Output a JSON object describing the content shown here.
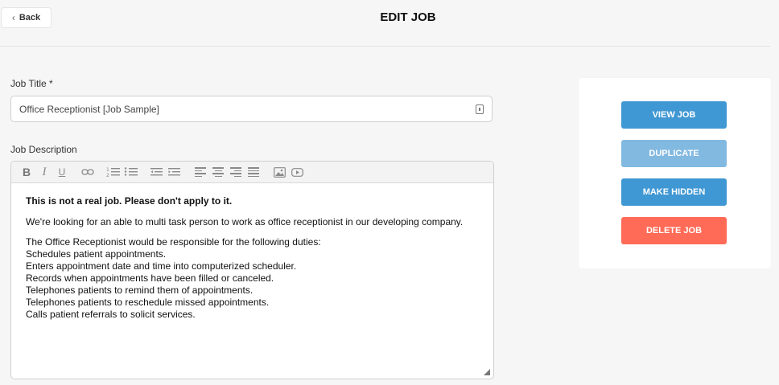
{
  "header": {
    "back_label": "Back",
    "page_title": "EDIT JOB"
  },
  "form": {
    "job_title_label": "Job Title *",
    "job_title_value": "Office Receptionist [Job Sample]",
    "job_description_label": "Job Description"
  },
  "editor": {
    "toolbar_icons": [
      "bold-icon",
      "italic-icon",
      "underline-icon",
      "link-icon",
      "ordered-list-icon",
      "bullet-list-icon",
      "outdent-icon",
      "indent-icon",
      "align-left-icon",
      "align-center-icon",
      "align-right-icon",
      "justify-icon",
      "image-icon",
      "video-icon"
    ],
    "notice": "This is not a real job. Please don't apply to it.",
    "intro": "We're looking for an able to multi task person to work as office receptionist in our developing company.",
    "duties_heading": "The Office Receptionist would be responsible for the following duties:",
    "duties": [
      "Schedules patient appointments.",
      "Enters appointment date and time into computerized scheduler.",
      "Records when appointments have been filled or canceled.",
      "Telephones patients to remind them of appointments.",
      "Telephones patients to reschedule missed appointments.",
      "Calls patient referrals to solicit services."
    ]
  },
  "actions": {
    "view_job": "VIEW JOB",
    "duplicate": "DUPLICATE",
    "make_hidden": "MAKE HIDDEN",
    "delete_job": "DELETE JOB"
  },
  "colors": {
    "primary_blue": "#3f97d3",
    "light_blue": "#82b9e1",
    "danger": "#ff6b57"
  }
}
